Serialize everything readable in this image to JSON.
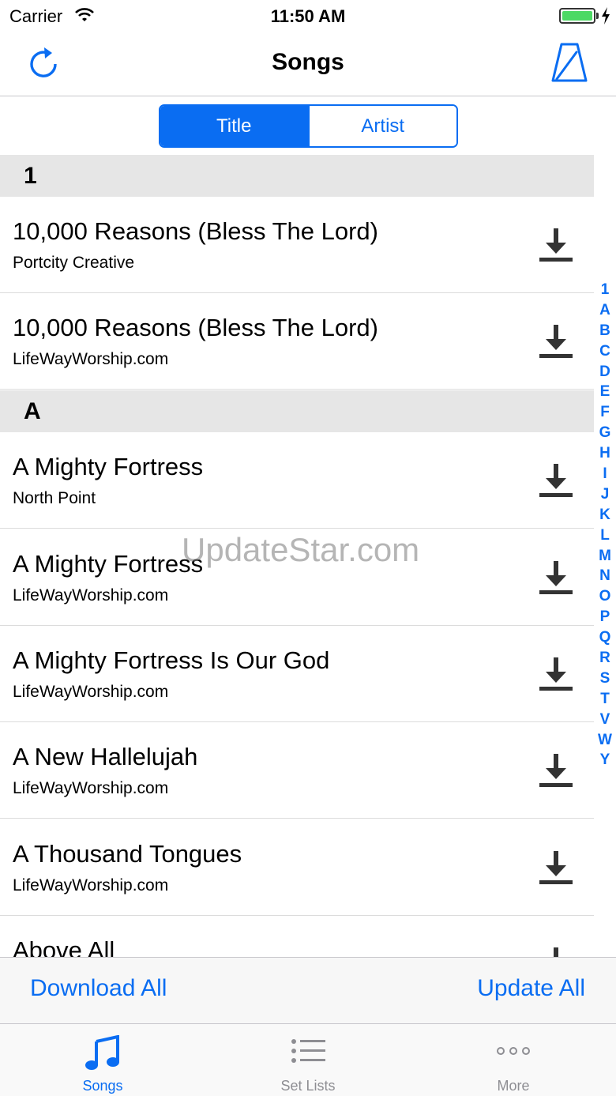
{
  "status_bar": {
    "carrier": "Carrier",
    "time": "11:50 AM"
  },
  "nav": {
    "title": "Songs"
  },
  "segmented": {
    "options": [
      "Title",
      "Artist"
    ],
    "selected": "Title"
  },
  "sections": [
    {
      "header": "1",
      "rows": [
        {
          "title": "10,000 Reasons (Bless The Lord)",
          "artist": "Portcity Creative"
        },
        {
          "title": "10,000 Reasons (Bless The Lord)",
          "artist": "LifeWayWorship.com"
        }
      ]
    },
    {
      "header": "A",
      "rows": [
        {
          "title": "A Mighty Fortress",
          "artist": "North Point"
        },
        {
          "title": "A Mighty Fortress",
          "artist": "LifeWayWorship.com"
        },
        {
          "title": "A Mighty Fortress Is Our God",
          "artist": "LifeWayWorship.com"
        },
        {
          "title": "A New Hallelujah",
          "artist": "LifeWayWorship.com"
        },
        {
          "title": "A Thousand Tongues",
          "artist": "LifeWayWorship.com"
        },
        {
          "title": "Above All",
          "artist": ""
        }
      ]
    }
  ],
  "index": [
    "1",
    "A",
    "B",
    "C",
    "D",
    "E",
    "F",
    "G",
    "H",
    "I",
    "J",
    "K",
    "L",
    "M",
    "N",
    "O",
    "P",
    "Q",
    "R",
    "S",
    "T",
    "V",
    "W",
    "Y"
  ],
  "watermark": "UpdateStar.com",
  "toolbar": {
    "download_all": "Download All",
    "update_all": "Update All"
  },
  "tabs": [
    {
      "label": "Songs",
      "icon": "music-note-icon",
      "active": true
    },
    {
      "label": "Set Lists",
      "icon": "list-icon",
      "active": false
    },
    {
      "label": "More",
      "icon": "more-dots-icon",
      "active": false
    }
  ],
  "colors": {
    "accent": "#0a6df2",
    "section_bg": "#e6e6e6",
    "inactive_tab": "#8e8e93",
    "battery": "#4cd964"
  }
}
